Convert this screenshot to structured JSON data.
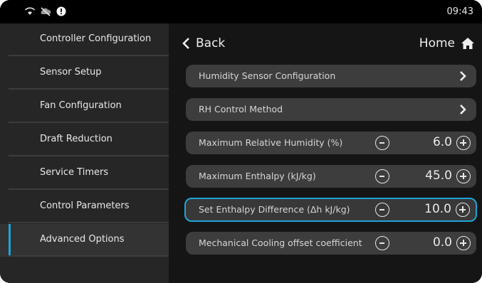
{
  "status": {
    "time": "09:43",
    "icons": [
      "wifi-icon",
      "cloud-offline-icon",
      "alert-icon"
    ]
  },
  "sidebar": {
    "items": [
      {
        "label": "Controller Configuration"
      },
      {
        "label": "Sensor Setup"
      },
      {
        "label": "Fan Configuration"
      },
      {
        "label": "Draft Reduction"
      },
      {
        "label": "Service Timers"
      },
      {
        "label": "Control Parameters"
      },
      {
        "label": "Advanced Options",
        "active": true
      }
    ]
  },
  "header": {
    "back_label": "Back",
    "home_label": "Home"
  },
  "settings": {
    "rows": [
      {
        "label": "Humidity Sensor Configuration",
        "type": "link"
      },
      {
        "label": "RH Control Method",
        "type": "link"
      },
      {
        "label": "Maximum Relative Humidity (%)",
        "type": "stepper",
        "value": "6.0"
      },
      {
        "label": "Maximum Enthalpy (kJ/kg)",
        "type": "stepper",
        "value": "45.0"
      },
      {
        "label": "Set Enthalpy Difference (Δh kJ/kg)",
        "type": "stepper",
        "value": "10.0",
        "selected": true
      },
      {
        "label": "Mechanical Cooling offset coefficient",
        "type": "stepper",
        "value": "0.0"
      }
    ]
  },
  "colors": {
    "accent": "#1fa3d8",
    "background": "#151515",
    "sidebar": "#262626",
    "row": "#3d3d3d"
  }
}
